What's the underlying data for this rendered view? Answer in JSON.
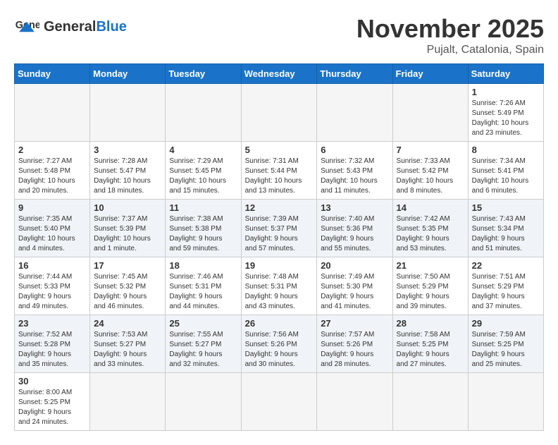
{
  "header": {
    "logo_general": "General",
    "logo_blue": "Blue",
    "title": "November 2025",
    "subtitle": "Pujalt, Catalonia, Spain"
  },
  "weekdays": [
    "Sunday",
    "Monday",
    "Tuesday",
    "Wednesday",
    "Thursday",
    "Friday",
    "Saturday"
  ],
  "weeks": [
    [
      {
        "day": "",
        "info": ""
      },
      {
        "day": "",
        "info": ""
      },
      {
        "day": "",
        "info": ""
      },
      {
        "day": "",
        "info": ""
      },
      {
        "day": "",
        "info": ""
      },
      {
        "day": "",
        "info": ""
      },
      {
        "day": "1",
        "info": "Sunrise: 7:26 AM\nSunset: 5:49 PM\nDaylight: 10 hours\nand 23 minutes."
      }
    ],
    [
      {
        "day": "2",
        "info": "Sunrise: 7:27 AM\nSunset: 5:48 PM\nDaylight: 10 hours\nand 20 minutes."
      },
      {
        "day": "3",
        "info": "Sunrise: 7:28 AM\nSunset: 5:47 PM\nDaylight: 10 hours\nand 18 minutes."
      },
      {
        "day": "4",
        "info": "Sunrise: 7:29 AM\nSunset: 5:45 PM\nDaylight: 10 hours\nand 15 minutes."
      },
      {
        "day": "5",
        "info": "Sunrise: 7:31 AM\nSunset: 5:44 PM\nDaylight: 10 hours\nand 13 minutes."
      },
      {
        "day": "6",
        "info": "Sunrise: 7:32 AM\nSunset: 5:43 PM\nDaylight: 10 hours\nand 11 minutes."
      },
      {
        "day": "7",
        "info": "Sunrise: 7:33 AM\nSunset: 5:42 PM\nDaylight: 10 hours\nand 8 minutes."
      },
      {
        "day": "8",
        "info": "Sunrise: 7:34 AM\nSunset: 5:41 PM\nDaylight: 10 hours\nand 6 minutes."
      }
    ],
    [
      {
        "day": "9",
        "info": "Sunrise: 7:35 AM\nSunset: 5:40 PM\nDaylight: 10 hours\nand 4 minutes."
      },
      {
        "day": "10",
        "info": "Sunrise: 7:37 AM\nSunset: 5:39 PM\nDaylight: 10 hours\nand 1 minute."
      },
      {
        "day": "11",
        "info": "Sunrise: 7:38 AM\nSunset: 5:38 PM\nDaylight: 9 hours\nand 59 minutes."
      },
      {
        "day": "12",
        "info": "Sunrise: 7:39 AM\nSunset: 5:37 PM\nDaylight: 9 hours\nand 57 minutes."
      },
      {
        "day": "13",
        "info": "Sunrise: 7:40 AM\nSunset: 5:36 PM\nDaylight: 9 hours\nand 55 minutes."
      },
      {
        "day": "14",
        "info": "Sunrise: 7:42 AM\nSunset: 5:35 PM\nDaylight: 9 hours\nand 53 minutes."
      },
      {
        "day": "15",
        "info": "Sunrise: 7:43 AM\nSunset: 5:34 PM\nDaylight: 9 hours\nand 51 minutes."
      }
    ],
    [
      {
        "day": "16",
        "info": "Sunrise: 7:44 AM\nSunset: 5:33 PM\nDaylight: 9 hours\nand 49 minutes."
      },
      {
        "day": "17",
        "info": "Sunrise: 7:45 AM\nSunset: 5:32 PM\nDaylight: 9 hours\nand 46 minutes."
      },
      {
        "day": "18",
        "info": "Sunrise: 7:46 AM\nSunset: 5:31 PM\nDaylight: 9 hours\nand 44 minutes."
      },
      {
        "day": "19",
        "info": "Sunrise: 7:48 AM\nSunset: 5:31 PM\nDaylight: 9 hours\nand 43 minutes."
      },
      {
        "day": "20",
        "info": "Sunrise: 7:49 AM\nSunset: 5:30 PM\nDaylight: 9 hours\nand 41 minutes."
      },
      {
        "day": "21",
        "info": "Sunrise: 7:50 AM\nSunset: 5:29 PM\nDaylight: 9 hours\nand 39 minutes."
      },
      {
        "day": "22",
        "info": "Sunrise: 7:51 AM\nSunset: 5:29 PM\nDaylight: 9 hours\nand 37 minutes."
      }
    ],
    [
      {
        "day": "23",
        "info": "Sunrise: 7:52 AM\nSunset: 5:28 PM\nDaylight: 9 hours\nand 35 minutes."
      },
      {
        "day": "24",
        "info": "Sunrise: 7:53 AM\nSunset: 5:27 PM\nDaylight: 9 hours\nand 33 minutes."
      },
      {
        "day": "25",
        "info": "Sunrise: 7:55 AM\nSunset: 5:27 PM\nDaylight: 9 hours\nand 32 minutes."
      },
      {
        "day": "26",
        "info": "Sunrise: 7:56 AM\nSunset: 5:26 PM\nDaylight: 9 hours\nand 30 minutes."
      },
      {
        "day": "27",
        "info": "Sunrise: 7:57 AM\nSunset: 5:26 PM\nDaylight: 9 hours\nand 28 minutes."
      },
      {
        "day": "28",
        "info": "Sunrise: 7:58 AM\nSunset: 5:25 PM\nDaylight: 9 hours\nand 27 minutes."
      },
      {
        "day": "29",
        "info": "Sunrise: 7:59 AM\nSunset: 5:25 PM\nDaylight: 9 hours\nand 25 minutes."
      }
    ],
    [
      {
        "day": "30",
        "info": "Sunrise: 8:00 AM\nSunset: 5:25 PM\nDaylight: 9 hours\nand 24 minutes."
      },
      {
        "day": "",
        "info": ""
      },
      {
        "day": "",
        "info": ""
      },
      {
        "day": "",
        "info": ""
      },
      {
        "day": "",
        "info": ""
      },
      {
        "day": "",
        "info": ""
      },
      {
        "day": "",
        "info": ""
      }
    ]
  ]
}
